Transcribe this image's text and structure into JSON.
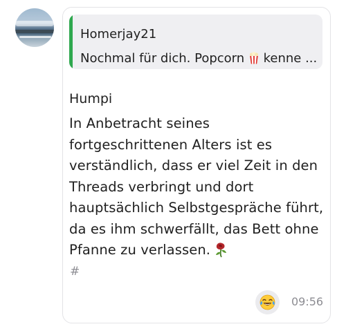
{
  "message": {
    "quote": {
      "author": "Homerjay21",
      "text_before_emoji": "Nochmal für dich. Popcorn ",
      "emoji": "popcorn-icon",
      "text_after_emoji": " kenne ..."
    },
    "sender": "Humpi",
    "body": "In Anbetracht seines fortgeschrittenen Alters ist es verständlich, dass er viel Zeit in den Threads verbringt und dort hauptsächlich Selbstgespräche führt, da es ihm schwerfällt, das Bett ohne Pfanne zu verlassen.",
    "body_emoji": "wilted-rose-icon",
    "hashtag": "#",
    "reaction_emoji": "tears-of-joy-icon",
    "time": "09:56"
  },
  "colors": {
    "quote_bar": "#2fa84f",
    "quote_background": "#efeff2",
    "bubble_border": "#e3e3e6",
    "muted_text": "#8c8c92"
  }
}
